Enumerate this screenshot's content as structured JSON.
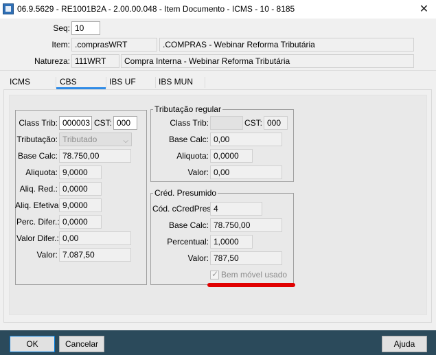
{
  "window": {
    "title": "06.9.5629 - RE1001B2A - 2.00.00.048 - Item Documento - ICMS - 10 - 8185",
    "close_glyph": "✕"
  },
  "header": {
    "seq_label": "Seq:",
    "seq_value": "10",
    "item_label": "Item:",
    "item_code": ".comprasWRT",
    "item_desc": ".COMPRAS - Webinar Reforma Tributária",
    "natureza_label": "Natureza:",
    "natureza_code": "111WRT",
    "natureza_desc": "Compra Interna - Webinar Reforma Tributária"
  },
  "tabs": [
    {
      "label": "ICMS"
    },
    {
      "label": "CBS"
    },
    {
      "label": "IBS UF"
    },
    {
      "label": "IBS MUN"
    }
  ],
  "active_tab": "CBS",
  "left": {
    "class_trib_label": "Class Trib:",
    "class_trib_value": "000003",
    "cst_label": "CST:",
    "cst_value": "000",
    "tributacao_label": "Tributação:",
    "tributacao_value": "Tributado",
    "base_calc_label": "Base Calc:",
    "base_calc_value": "78.750,00",
    "aliquota_label": "Aliquota:",
    "aliquota_value": "9,0000",
    "aliq_red_label": "Aliq. Red.:",
    "aliq_red_value": "0,0000",
    "aliq_efetiva_label": "Aliq. Efetiva:",
    "aliq_efetiva_value": "9,0000",
    "perc_difer_label": "Perc. Difer.:",
    "perc_difer_value": "0,0000",
    "valor_difer_label": "Valor Difer.:",
    "valor_difer_value": "0,00",
    "valor_label": "Valor:",
    "valor_value": "7.087,50"
  },
  "regular": {
    "title": "Tributação regular",
    "class_trib_label": "Class Trib:",
    "class_trib_value": "",
    "cst_label": "CST:",
    "cst_value": "000",
    "base_calc_label": "Base Calc:",
    "base_calc_value": "0,00",
    "aliquota_label": "Aliquota:",
    "aliquota_value": "0,0000",
    "valor_label": "Valor:",
    "valor_value": "0,00"
  },
  "presumido": {
    "title": "Créd. Presumido",
    "cod_label": "Cód. cCredPres:",
    "cod_value": "4",
    "base_calc_label": "Base Calc:",
    "base_calc_value": "78.750,00",
    "percentual_label": "Percentual:",
    "percentual_value": "1,0000",
    "valor_label": "Valor:",
    "valor_value": "787,50",
    "bem_movel_label": "Bem móvel usado"
  },
  "footer": {
    "ok_label": "OK",
    "cancel_label": "Cancelar",
    "help_label": "Ajuda"
  },
  "colors": {
    "accent": "#2f8be6",
    "bottom_bar": "#2b4a5b",
    "highlight": "#e00000"
  }
}
